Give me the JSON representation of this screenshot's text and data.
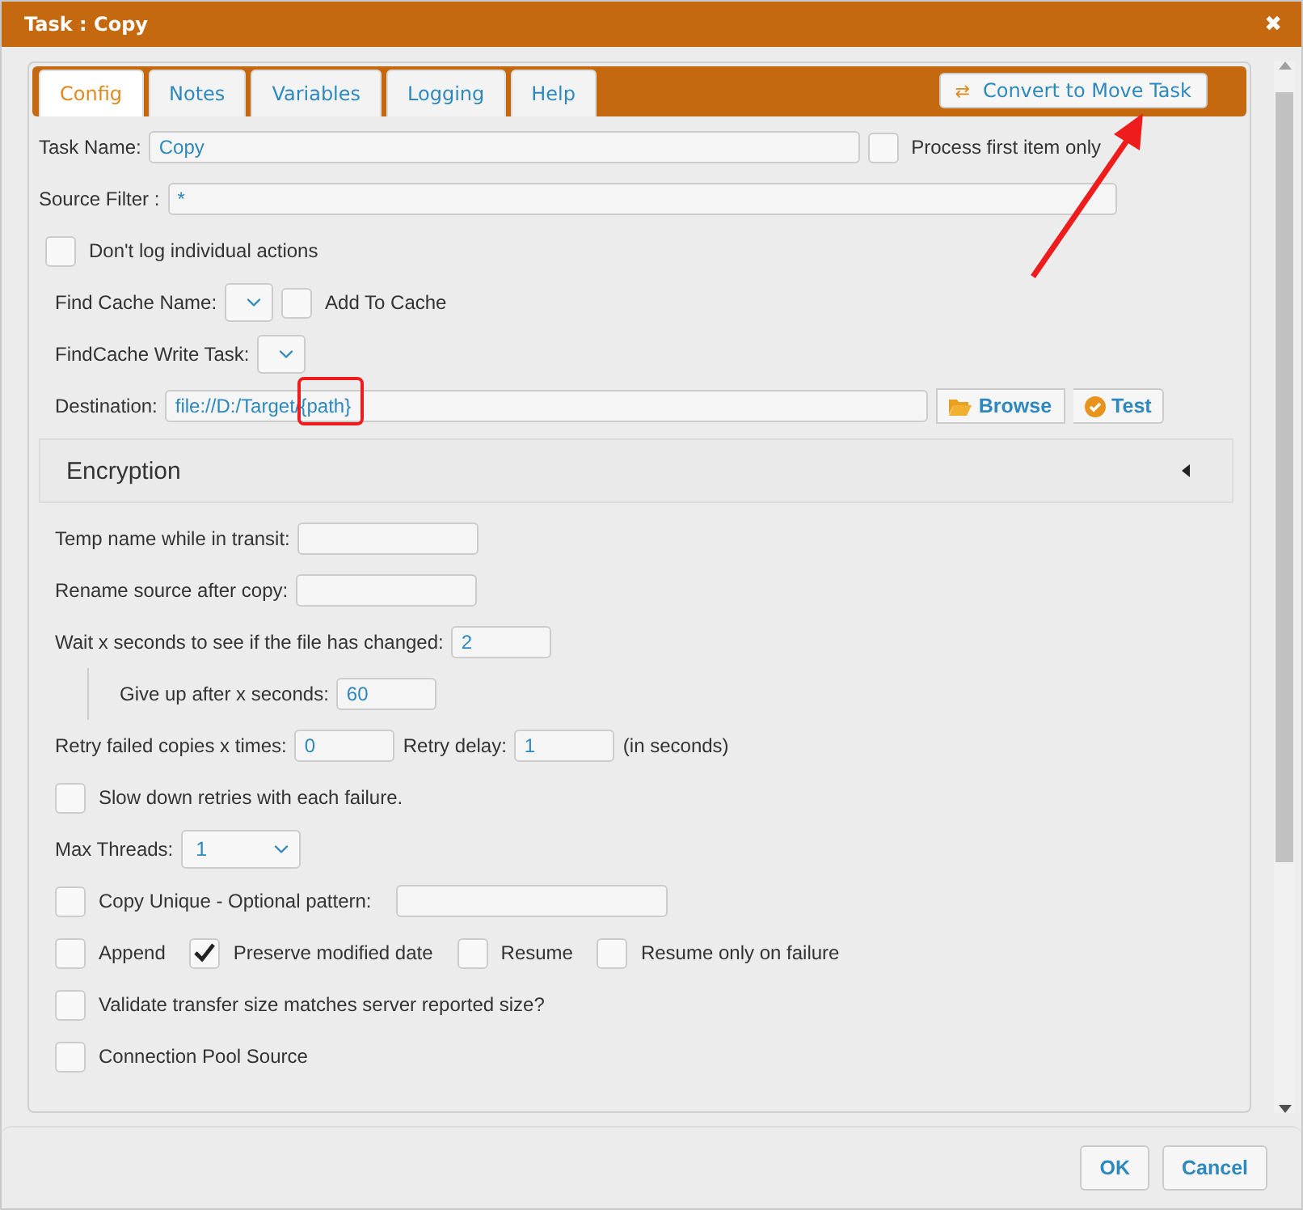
{
  "window": {
    "title": "Task : Copy",
    "close": "✖"
  },
  "tabs": [
    {
      "label": "Config",
      "selected": true
    },
    {
      "label": "Notes",
      "selected": false
    },
    {
      "label": "Variables",
      "selected": false
    },
    {
      "label": "Logging",
      "selected": false
    },
    {
      "label": "Help",
      "selected": false
    }
  ],
  "convert_button": {
    "icon": "⇄",
    "label": "Convert to Move Task"
  },
  "rows": [
    {
      "kind": "top",
      "items": [
        {
          "kind": "label",
          "text": "Task Name:"
        },
        {
          "kind": "long_field",
          "value": "Copy"
        },
        {
          "kind": "checkbox",
          "label": "Process first item only",
          "checked": false
        }
      ]
    },
    {
      "kind": "top",
      "items": [
        {
          "kind": "label",
          "text": "Source Filter :"
        },
        {
          "kind": "long_field",
          "value": "*"
        }
      ]
    },
    {
      "kind": "check",
      "items": [
        {
          "kind": "checkbox",
          "label": "Don't log individual actions",
          "checked": false
        }
      ]
    },
    {
      "kind": "plain",
      "items": [
        {
          "kind": "label",
          "text": "Find Cache Name:"
        },
        {
          "kind": "select"
        },
        {
          "kind": "checkbox",
          "label": "Add To Cache",
          "checked": false
        }
      ]
    },
    {
      "kind": "plain",
      "items": [
        {
          "kind": "label",
          "text": "FindCache Write Task:"
        },
        {
          "kind": "select"
        }
      ]
    },
    {
      "kind": "plain",
      "items": [
        {
          "kind": "label",
          "text": "Destination:"
        },
        {
          "kind": "dest_field",
          "value": "file://D:/Target/{path}"
        },
        {
          "kind": "browse",
          "label": "Browse"
        },
        {
          "kind": "test",
          "label": "Test"
        }
      ]
    },
    {
      "kind": "section",
      "title": "Encryption",
      "expanded": false
    },
    {
      "kind": "plain",
      "items": [
        {
          "kind": "label",
          "text": "Temp name while in transit:"
        },
        {
          "kind": "field",
          "value": ""
        }
      ]
    },
    {
      "kind": "plain",
      "items": [
        {
          "kind": "label",
          "text": "Rename source after copy:"
        },
        {
          "kind": "field",
          "value": ""
        }
      ]
    },
    {
      "kind": "plain",
      "items": [
        {
          "kind": "label",
          "text": "Wait x seconds to see if the file has changed:"
        },
        {
          "kind": "small_field",
          "value": "2"
        }
      ]
    },
    {
      "kind": "indented",
      "items": [
        {
          "kind": "label",
          "text": "Give up after x seconds:"
        },
        {
          "kind": "small_field",
          "value": "60"
        }
      ]
    },
    {
      "kind": "plain",
      "items": [
        {
          "kind": "label",
          "text": "Retry failed copies x times:"
        },
        {
          "kind": "small_field",
          "value": "0"
        },
        {
          "kind": "label",
          "text": "Retry delay:"
        },
        {
          "kind": "small_field",
          "value": "1"
        },
        {
          "kind": "label",
          "text": "(in seconds)"
        }
      ]
    },
    {
      "kind": "plain",
      "items": [
        {
          "kind": "checkbox",
          "label": "Slow down retries with each failure.",
          "checked": false
        }
      ]
    },
    {
      "kind": "plain",
      "items": [
        {
          "kind": "label",
          "text": "Max Threads:"
        },
        {
          "kind": "value_select",
          "value": "1"
        }
      ]
    },
    {
      "kind": "plain",
      "items": [
        {
          "kind": "checkbox",
          "label": "Copy Unique - Optional pattern:",
          "checked": false
        },
        {
          "kind": "pattern_field",
          "value": ""
        }
      ]
    },
    {
      "kind": "plain",
      "items": [
        {
          "kind": "checkbox",
          "label": "Append",
          "checked": false
        },
        {
          "kind": "checkbox",
          "label": "Preserve modified date",
          "checked": true
        },
        {
          "kind": "checkbox",
          "label": "Resume",
          "checked": false
        },
        {
          "kind": "checkbox",
          "label": "Resume only on failure",
          "checked": false
        }
      ]
    },
    {
      "kind": "plain",
      "items": [
        {
          "kind": "checkbox",
          "label": "Validate transfer size matches server reported size?",
          "checked": false
        }
      ]
    },
    {
      "kind": "plain",
      "items": [
        {
          "kind": "checkbox",
          "label": "Connection Pool Source",
          "checked": false
        }
      ]
    }
  ],
  "footer_buttons": [
    "OK",
    "Cancel"
  ]
}
